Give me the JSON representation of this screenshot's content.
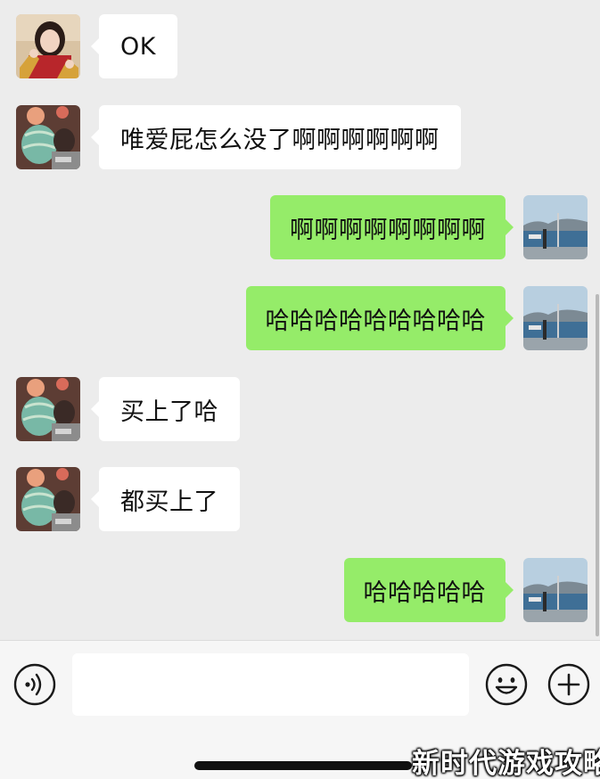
{
  "messages": [
    {
      "side": "in",
      "avatar": "girl-red-avatar",
      "text": "OK"
    },
    {
      "side": "in",
      "avatar": "girl-lantern-avatar",
      "text": "唯爱屁怎么没了啊啊啊啊啊啊"
    },
    {
      "side": "out",
      "avatar": "seaside-avatar",
      "text": "啊啊啊啊啊啊啊啊"
    },
    {
      "side": "out",
      "avatar": "seaside-avatar",
      "text": "哈哈哈哈哈哈哈哈哈"
    },
    {
      "side": "in",
      "avatar": "girl-lantern-avatar",
      "text": "买上了哈"
    },
    {
      "side": "in",
      "avatar": "girl-lantern-avatar",
      "text": "都买上了"
    },
    {
      "side": "out",
      "avatar": "seaside-avatar",
      "text": "哈哈哈哈哈"
    }
  ],
  "input": {
    "value": "",
    "placeholder": ""
  },
  "icons": {
    "voice": "voice-icon",
    "emoji": "emoji-icon",
    "plus": "plus-icon"
  },
  "colors": {
    "background": "#ececec",
    "incoming_bubble": "#ffffff",
    "outgoing_bubble": "#95ec69",
    "input_bar": "#f6f6f6"
  },
  "watermark": "新时代游戏攻略"
}
